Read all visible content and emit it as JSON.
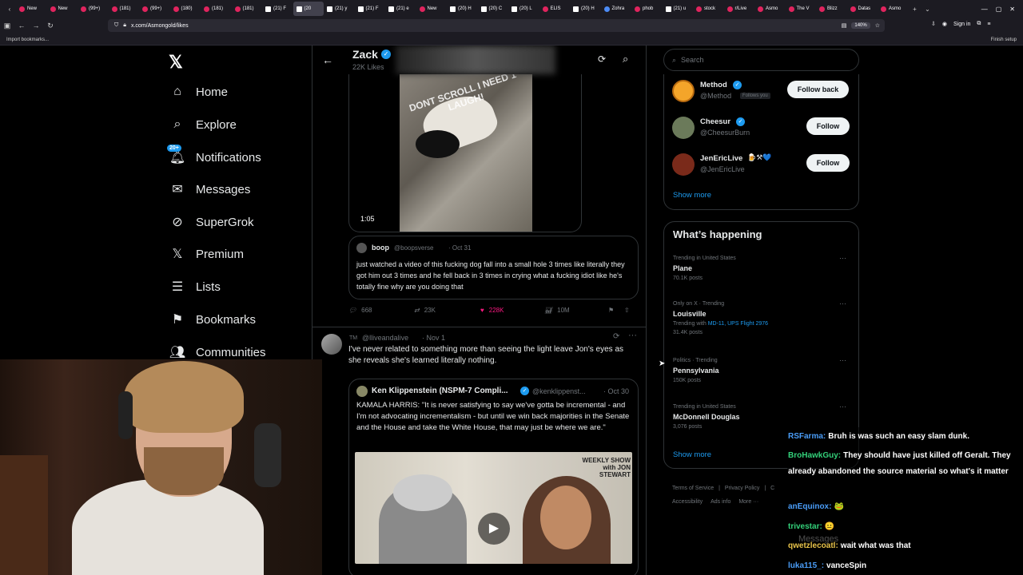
{
  "browser": {
    "tabs": [
      "New",
      "New",
      "(99+)",
      "(181)",
      "(99+)",
      "(180)",
      "(181)",
      "(181)",
      "(21) F",
      "(20",
      "(21) y",
      "(21) F",
      "(21) e",
      "New",
      "(20) H",
      "(20) C",
      "(20) L",
      "ELIS",
      "(20) H",
      "Zohra",
      "phob",
      "(21) u",
      "stock",
      "r/Live",
      "Asmo",
      "The V",
      "Blizz",
      "Datas",
      "Asmo"
    ],
    "active_tab_index": 9,
    "url": "x.com/Asmongold/likes",
    "zoom": "140%",
    "sign_in": "Sign in",
    "import_bookmarks": "Import bookmarks...",
    "finish_setup": "Finish setup"
  },
  "leftnav": {
    "items": [
      {
        "label": "Home",
        "icon": "home-icon"
      },
      {
        "label": "Explore",
        "icon": "search-icon"
      },
      {
        "label": "Notifications",
        "icon": "bell-icon",
        "badge": "20+"
      },
      {
        "label": "Messages",
        "icon": "mail-icon"
      },
      {
        "label": "SuperGrok",
        "icon": "grok-icon"
      },
      {
        "label": "Premium",
        "icon": "x-icon"
      },
      {
        "label": "Lists",
        "icon": "list-icon"
      },
      {
        "label": "Bookmarks",
        "icon": "bookmark-icon"
      },
      {
        "label": "Communities",
        "icon": "communities-icon"
      }
    ]
  },
  "feed": {
    "header": {
      "name": "Zack",
      "likes": "22K Likes"
    },
    "post1": {
      "video_duration": "1:05",
      "video_overlay_text": "DONT SCROLL I NEED 1 LAUGH!",
      "quote": {
        "name": "boop",
        "handle": "@boopsverse",
        "date": "· Oct 31",
        "text": "just watched a video of this fucking dog fall into a small hole 3 times like literally they got him out 3 times and he fell back in 3 times in crying what a fucking idiot like he's totally fine why are you doing that"
      },
      "replies": "668",
      "reposts": "23K",
      "likes": "228K",
      "views": "10M"
    },
    "post2": {
      "name": "TM",
      "handle": "@lliveandalive",
      "date": "· Nov 1",
      "text": "I've never related to something more than seeing the light leave Jon's eyes as she reveals she's learned literally nothing.",
      "quote": {
        "name": "Ken Klippenstein (NSPM-7 Compli...",
        "handle": "@kenklippenst...",
        "date": "· Oct 30",
        "text": "KAMALA HARRIS: \"It is never satisfying to say we've gotta be incremental - and I'm not advocating incrementalism - but until we win back majorities in the Senate and the House and take the White House, that may just be where we are.\"",
        "video_label": "WEEKLY SHOW with JON STEWART"
      }
    }
  },
  "right": {
    "search_placeholder": "Search",
    "who_to_follow": [
      {
        "name": "Method",
        "handle": "@Method",
        "follows_you": "Follows you",
        "button": "Follow back",
        "verified": true
      },
      {
        "name": "Cheesur",
        "handle": "@CheesurBurn",
        "button": "Follow",
        "verified": true
      },
      {
        "name": "JenEricLive",
        "handle": "@JenEricLive",
        "button": "Follow",
        "verified": false,
        "emojis": "🍺⚒💙"
      }
    ],
    "show_more": "Show more",
    "happening_title": "What’s happening",
    "trends": [
      {
        "meta": "Trending in United States",
        "name": "Plane",
        "count": "70.1K posts"
      },
      {
        "meta": "Only on X · Trending",
        "name": "Louisville",
        "with_label": "Trending with",
        "with_links": "MD-11, UPS Flight 2976",
        "count": "31.4K posts"
      },
      {
        "meta": "Politics · Trending",
        "name": "Pennsylvania",
        "count": "150K posts"
      },
      {
        "meta": "Trending in United States",
        "name": "McDonnell Douglas",
        "count": "3,076 posts"
      }
    ],
    "show_more2": "Show more",
    "footer": [
      "Terms of Service",
      "|",
      "Privacy Policy",
      "|",
      "C",
      "Accessibility",
      "Ads info",
      "More ···"
    ]
  },
  "chat": [
    {
      "user": "RSFarma:",
      "color": "#4a9df8",
      "text": "Bruh is was such an easy slam dunk."
    },
    {
      "user": "BroHawkGuy:",
      "color": "#33d17a",
      "text": "They should have just killed off Geralt. They already abandoned the source material so what's it matter"
    },
    {
      "user": "anEquinox:",
      "color": "#4a9df8",
      "text": "🐸"
    },
    {
      "user": "trivestar:",
      "color": "#33d17a",
      "text": "😐"
    },
    {
      "user": "qwetzlecoatl:",
      "color": "#e8c34a",
      "text": "wait what was that"
    },
    {
      "user": "luka115_:",
      "color": "#4a9df8",
      "text": "vanceSpin"
    }
  ],
  "chat_overlay_text": "Messages"
}
